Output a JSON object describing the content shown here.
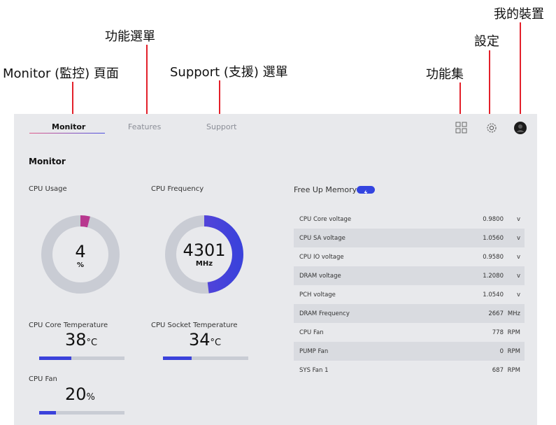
{
  "callouts": {
    "my_device": "我的裝置",
    "features_menu": "功能選單",
    "settings": "設定",
    "monitor_page": "Monitor (監控) 頁面",
    "support_menu": "Support (支援) 選單",
    "feature_set": "功能集"
  },
  "tabs": [
    {
      "label": "Monitor",
      "active": true
    },
    {
      "label": "Features",
      "active": false
    },
    {
      "label": "Support",
      "active": false
    }
  ],
  "toolbar_icons": [
    "grid-icon",
    "gear-icon",
    "avatar"
  ],
  "monitor": {
    "title": "Monitor",
    "cpu_usage": {
      "label": "CPU Usage",
      "value": "4",
      "unit": "%",
      "fraction": 0.04
    },
    "cpu_frequency": {
      "label": "CPU Frequency",
      "value": "4301",
      "unit": "MHz",
      "fraction": 0.48
    },
    "cpu_core_temp": {
      "label": "CPU Core Temperature",
      "value": "38",
      "unit": "°C",
      "fraction": 0.38
    },
    "cpu_socket_temp": {
      "label": "CPU Socket Temperature",
      "value": "34",
      "unit": "°C",
      "fraction": 0.34
    },
    "cpu_fan": {
      "label": "CPU Fan",
      "value": "20",
      "unit": "%",
      "fraction": 0.2
    }
  },
  "free_up_memory": {
    "label": "Free Up Memory"
  },
  "readings": [
    {
      "name": "CPU Core voltage",
      "value": "0.9800",
      "unit": "v"
    },
    {
      "name": "CPU SA voltage",
      "value": "1.0560",
      "unit": "v"
    },
    {
      "name": "CPU IO voltage",
      "value": "0.9580",
      "unit": "v"
    },
    {
      "name": "DRAM voltage",
      "value": "1.2080",
      "unit": "v"
    },
    {
      "name": "PCH voltage",
      "value": "1.0540",
      "unit": "v"
    },
    {
      "name": "DRAM Frequency",
      "value": "2667",
      "unit": "MHz"
    },
    {
      "name": "CPU Fan",
      "value": "778",
      "unit": "RPM"
    },
    {
      "name": "PUMP Fan",
      "value": "0",
      "unit": "RPM"
    },
    {
      "name": "SYS Fan 1",
      "value": "687",
      "unit": "RPM"
    }
  ],
  "colors": {
    "accent": "#3b42db",
    "gauge_track": "#c9ccd4",
    "gauge_start": "#b8388f",
    "callout_line": "#e3202a"
  }
}
